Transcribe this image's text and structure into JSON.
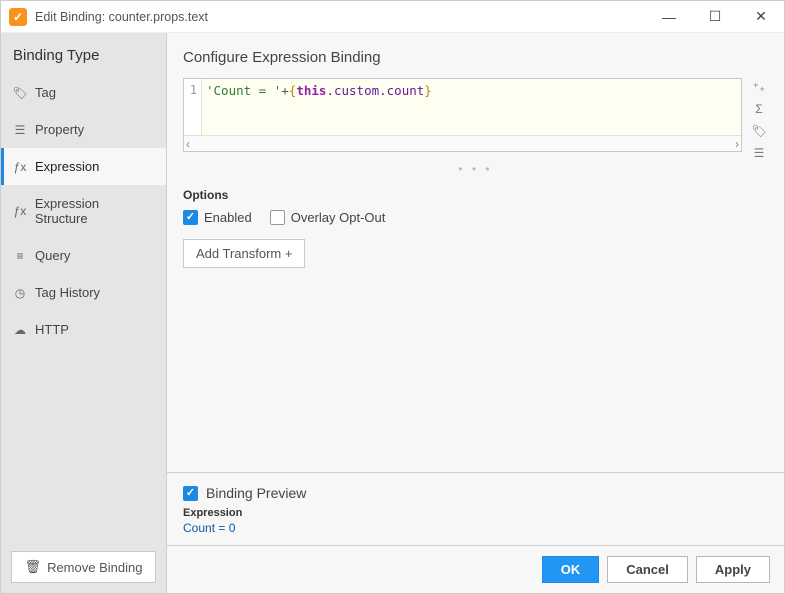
{
  "window": {
    "title": "Edit Binding: counter.props.text",
    "logo_glyph": "✓"
  },
  "sidebar": {
    "header": "Binding Type",
    "items": [
      {
        "label": "Tag",
        "icon": "🏷"
      },
      {
        "label": "Property",
        "icon": "☰"
      },
      {
        "label": "Expression",
        "icon": "ƒx"
      },
      {
        "label": "Expression Structure",
        "icon": "ƒx"
      },
      {
        "label": "Query",
        "icon": "≡"
      },
      {
        "label": "Tag History",
        "icon": "◷"
      },
      {
        "label": "HTTP",
        "icon": "☁"
      }
    ],
    "active_index": 2,
    "remove_label": "Remove Binding",
    "remove_icon": "🗑"
  },
  "main": {
    "config_title": "Configure Expression Binding",
    "editor": {
      "line_number": "1",
      "string_part": "'Count = '",
      "op": "+",
      "brace_open": "{",
      "this_kw": "this",
      "path_rest": ".custom.count",
      "brace_close": "}"
    },
    "side_tools": [
      "⁺₊",
      "Σ",
      "🏷",
      "☰"
    ],
    "drag_dots": "• • •",
    "options_label": "Options",
    "enabled_label": "Enabled",
    "overlay_label": "Overlay Opt-Out",
    "enabled_checked": true,
    "overlay_checked": false,
    "transform_label": "Add Transform +"
  },
  "preview": {
    "header": "Binding Preview",
    "checked": true,
    "sub": "Expression",
    "value": "Count = 0"
  },
  "footer": {
    "ok": "OK",
    "cancel": "Cancel",
    "apply": "Apply"
  }
}
